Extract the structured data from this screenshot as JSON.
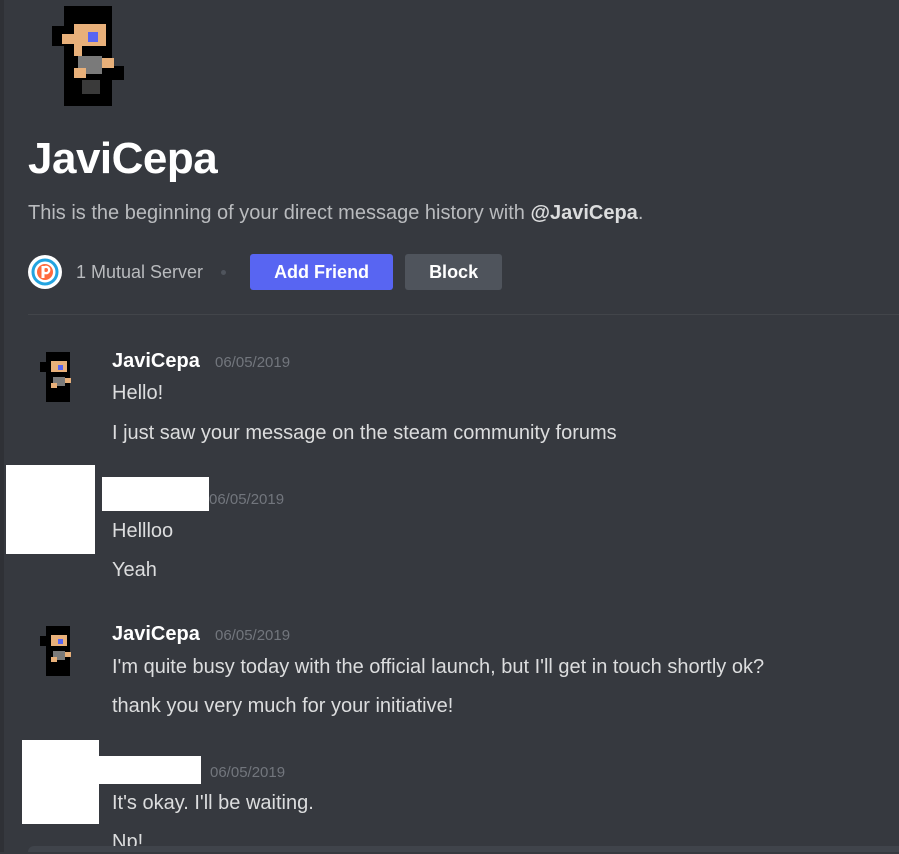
{
  "profile": {
    "name": "JaviCepa",
    "intro_prefix": "This is the beginning of your direct message history with ",
    "intro_handle": "@JaviCepa",
    "intro_suffix": ".",
    "avatar_icon": "pixel-character-avatar"
  },
  "mutual": {
    "label": "1 Mutual Server",
    "server_icon": "server-p-logo-icon"
  },
  "actions": {
    "add_friend": "Add Friend",
    "block": "Block"
  },
  "messages": [
    {
      "author": "JaviCepa",
      "timestamp": "06/05/2019",
      "lines": [
        "Hello!",
        "I just saw your message on the steam community forums"
      ]
    },
    {
      "author": "",
      "timestamp": "06/05/2019",
      "lines": [
        "Hellloo",
        "Yeah"
      ]
    },
    {
      "author": "JaviCepa",
      "timestamp": "06/05/2019",
      "lines": [
        "I'm quite busy today with the official launch, but I'll get in touch shortly ok?",
        "thank you very much for your initiative!"
      ]
    },
    {
      "author": "",
      "timestamp": "06/05/2019",
      "lines": [
        "It's okay. I'll be waiting.",
        "Np!"
      ]
    }
  ],
  "colors": {
    "background": "#36393f",
    "accent": "#5865f2",
    "secondary_button": "#4f545c",
    "timestamp": "#72767d"
  }
}
